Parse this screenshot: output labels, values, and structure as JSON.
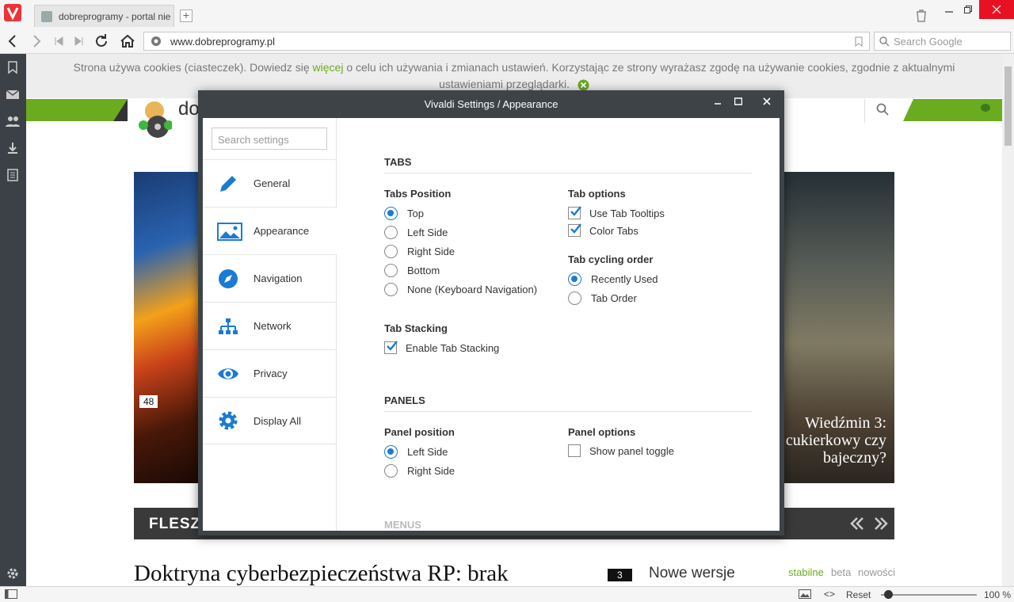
{
  "browser": {
    "tab_title": "dobreprogramy - portal nie",
    "url": "www.dobreprogramy.pl",
    "search_placeholder": "Search Google",
    "status": {
      "reset_label": "Reset",
      "zoom": "100 %"
    }
  },
  "page": {
    "cookie_text_1": "Strona używa cookies (ciasteczek). Dowiedz się ",
    "cookie_link": "więcej",
    "cookie_text_2": " o celu ich używania i zmianach ustawień. Korzystając ze strony wyrażasz zgodę na używanie cookies, zgodnie z aktualnymi ustawieniami przeglądarki.",
    "logo_text": "do",
    "comment_count": "48",
    "hero_title": "Wiedźmin 3: cukierkowy czy bajeczny?",
    "flesz": "FLESZ",
    "article_title": "Doktryna cyberbezpieczeństwa RP: brak",
    "article_comments": "3",
    "nowe_wersje": "Nowe wersje",
    "versions": [
      "stabilne",
      "beta",
      "nowości"
    ],
    "colors": {
      "accent_green": "#6bab1f"
    }
  },
  "dialog": {
    "title": "Vivaldi Settings / Appearance",
    "search_placeholder": "Search settings",
    "nav": [
      {
        "label": "General",
        "icon": "pencil-icon"
      },
      {
        "label": "Appearance",
        "icon": "image-icon"
      },
      {
        "label": "Navigation",
        "icon": "compass-icon"
      },
      {
        "label": "Network",
        "icon": "network-icon"
      },
      {
        "label": "Privacy",
        "icon": "eye-icon"
      },
      {
        "label": "Display All",
        "icon": "gear-icon"
      }
    ],
    "active_nav": "Appearance",
    "tabs_section": "TABS",
    "tabs_position": {
      "heading": "Tabs Position",
      "options": [
        "Top",
        "Left Side",
        "Right Side",
        "Bottom",
        "None (Keyboard Navigation)"
      ],
      "selected": "Top"
    },
    "tab_options": {
      "heading": "Tab options",
      "options": [
        {
          "label": "Use Tab Tooltips",
          "checked": true
        },
        {
          "label": "Color Tabs",
          "checked": true
        }
      ]
    },
    "tab_cycling": {
      "heading": "Tab cycling order",
      "options": [
        "Recently Used",
        "Tab Order"
      ],
      "selected": "Recently Used"
    },
    "tab_stacking": {
      "heading": "Tab Stacking",
      "option": {
        "label": "Enable Tab Stacking",
        "checked": true
      }
    },
    "panels_section": "PANELS",
    "panel_position": {
      "heading": "Panel position",
      "options": [
        "Left Side",
        "Right Side"
      ],
      "selected": "Left Side"
    },
    "panel_options": {
      "heading": "Panel options",
      "option": {
        "label": "Show panel toggle",
        "checked": false
      }
    },
    "menus_section": "MENUS",
    "colors": {
      "accent": "#1a7bd5",
      "titlebar": "#3d4347"
    }
  }
}
